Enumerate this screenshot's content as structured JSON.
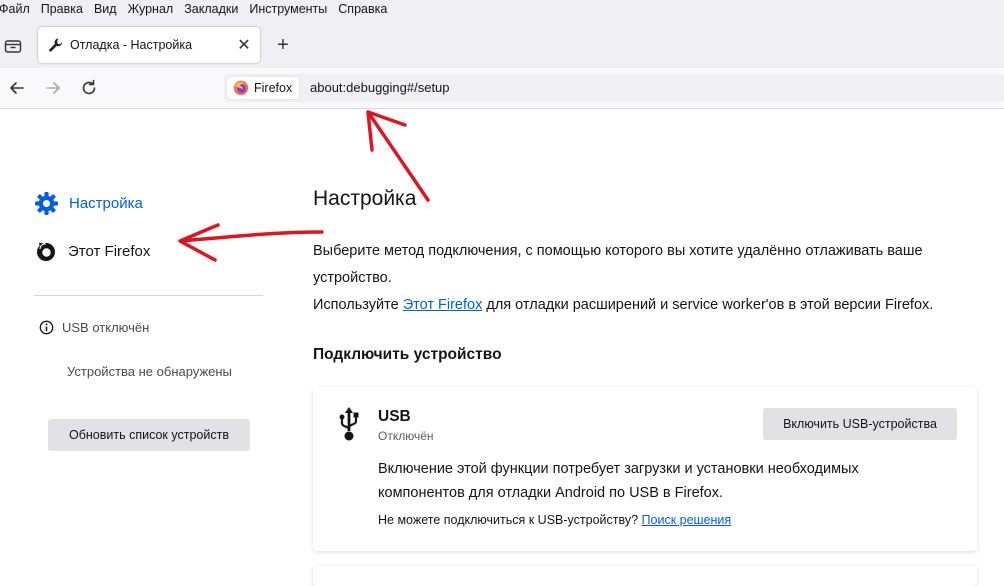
{
  "menu": [
    "Файл",
    "Правка",
    "Вид",
    "Журнал",
    "Закладки",
    "Инструменты",
    "Справка"
  ],
  "tab": {
    "title": "Отладка - Настройка",
    "close": "✕",
    "new_tab": "+"
  },
  "urlbar": {
    "identity": "Firefox",
    "url": "about:debugging#/setup"
  },
  "sidebar": {
    "setup_label": "Настройка",
    "this_firefox_label": "Этот Firefox",
    "usb_status": "USB отключён",
    "no_devices": "Устройства не обнаружены",
    "refresh_button": "Обновить список устройств"
  },
  "main": {
    "title": "Настройка",
    "desc1": "Выберите метод подключения, с помощью которого вы хотите удалённо отлаживать ваше устройство.",
    "desc2_pre": "Используйте ",
    "desc2_link": "Этот Firefox",
    "desc2_post": " для отладки расширений и service worker'ов в этой версии Firefox.",
    "connect_title": "Подключить устройство",
    "usb": {
      "name": "USB",
      "state": "Отключён",
      "enable_button": "Включить USB-устройства",
      "info": "Включение этой функции потребует загрузки и установки необходимых компонентов для отладки Android по USB в Firefox.",
      "help_pre": "Не можете подключиться к USB-устройству? ",
      "help_link": "Поиск решения"
    }
  },
  "colors": {
    "accent": "#0061e0",
    "sidebar_active": "#0060df",
    "annotation": "#e0141e"
  }
}
